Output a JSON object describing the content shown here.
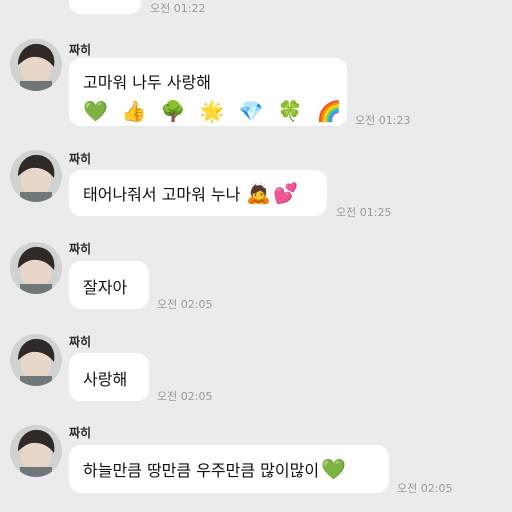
{
  "top": {
    "time": "오전 01:22"
  },
  "messages": [
    {
      "sender": "짜히",
      "text": "고마워 나두 사랑해",
      "emojis": [
        "💚",
        "👍",
        "🌳",
        "🌟",
        "💎",
        "🍀",
        "🌈"
      ],
      "time": "오전 01:23"
    },
    {
      "sender": "짜히",
      "text": "태어나줘서 고마워 누나",
      "emojis": [
        "🙇",
        "💕"
      ],
      "time": "오전 01:25"
    },
    {
      "sender": "짜히",
      "text": "잘자아",
      "time": "오전 02:05"
    },
    {
      "sender": "짜히",
      "text": "사랑해",
      "time": "오전 02:05"
    },
    {
      "sender": "짜히",
      "text": "하늘만큼 땅만큼 우주만큼 많이많이",
      "emojis": [
        "💚"
      ],
      "time": "오전 02:05"
    }
  ],
  "colors": {
    "background": "#ebebeb",
    "bubble": "#ffffff",
    "time": "#9a9a9a"
  }
}
